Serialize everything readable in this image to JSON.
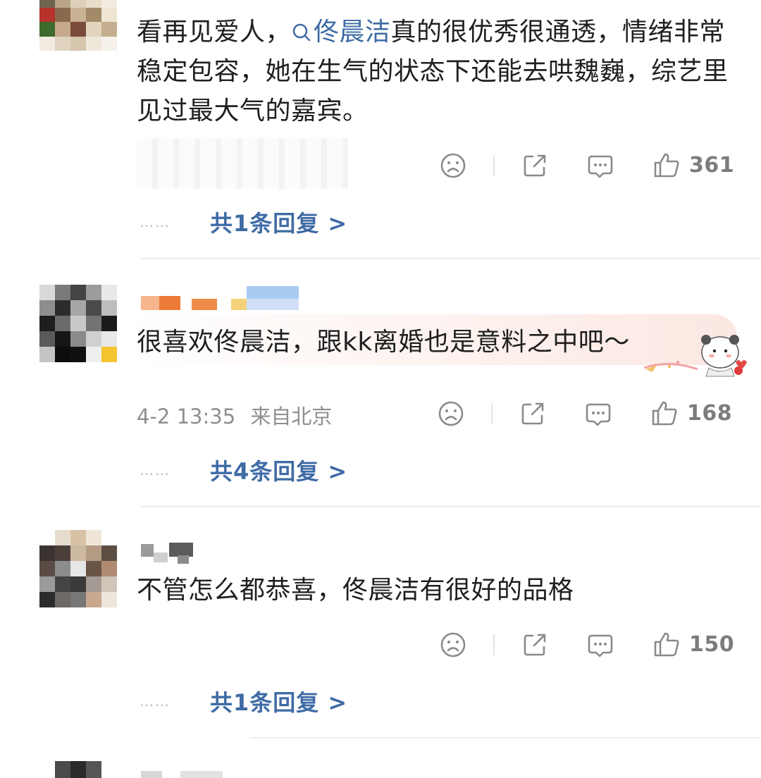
{
  "comments": [
    {
      "text_before": "看再见爱人，",
      "topic": "佟晨洁",
      "text_after": "真的很优秀很通透，情绪非常稳定包容，她在生气的状态下还能去哄魏巍，综艺里见过最大气的嘉宾。",
      "likes": "361",
      "replies_label": "共1条回复 >"
    },
    {
      "text": "很喜欢佟晨洁，跟kk离婚也是意料之中吧～",
      "timestamp": "4-2 13:35",
      "location": "来自北京",
      "likes": "168",
      "replies_label": "共4条回复 >"
    },
    {
      "text": "不管怎么都恭喜，佟晨洁有很好的品格",
      "likes": "150",
      "replies_label": "共1条回复 >"
    }
  ],
  "reply_dots": "……",
  "icons": {
    "dislike": "sad-face-icon",
    "share": "share-icon",
    "comment": "comment-icon",
    "like": "thumbs-up-icon"
  },
  "colors": {
    "topic_blue": "#3f6ba5",
    "meta_gray": "#8f8f8f",
    "bubble_pink": "#fbe7e2"
  }
}
